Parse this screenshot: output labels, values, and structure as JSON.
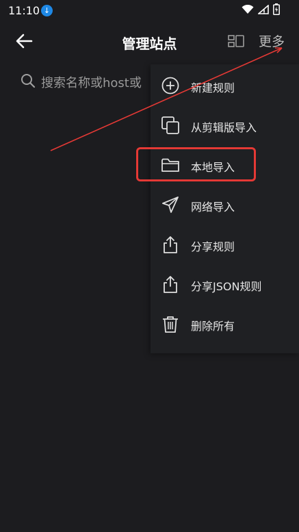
{
  "status_bar": {
    "time": "11:10"
  },
  "toolbar": {
    "title": "管理站点",
    "more_label": "更多"
  },
  "search": {
    "placeholder": "搜索名称或host或"
  },
  "menu": {
    "items": [
      {
        "label": "新建规则",
        "icon": "plus-circle-icon"
      },
      {
        "label": "从剪辑版导入",
        "icon": "copy-icon"
      },
      {
        "label": "本地导入",
        "icon": "folder-icon"
      },
      {
        "label": "网络导入",
        "icon": "send-icon"
      },
      {
        "label": "分享规则",
        "icon": "share-icon"
      },
      {
        "label": "分享JSON规则",
        "icon": "share-icon"
      },
      {
        "label": "删除所有",
        "icon": "trash-icon"
      }
    ]
  },
  "annotation": {
    "highlight_color": "#e53935"
  }
}
